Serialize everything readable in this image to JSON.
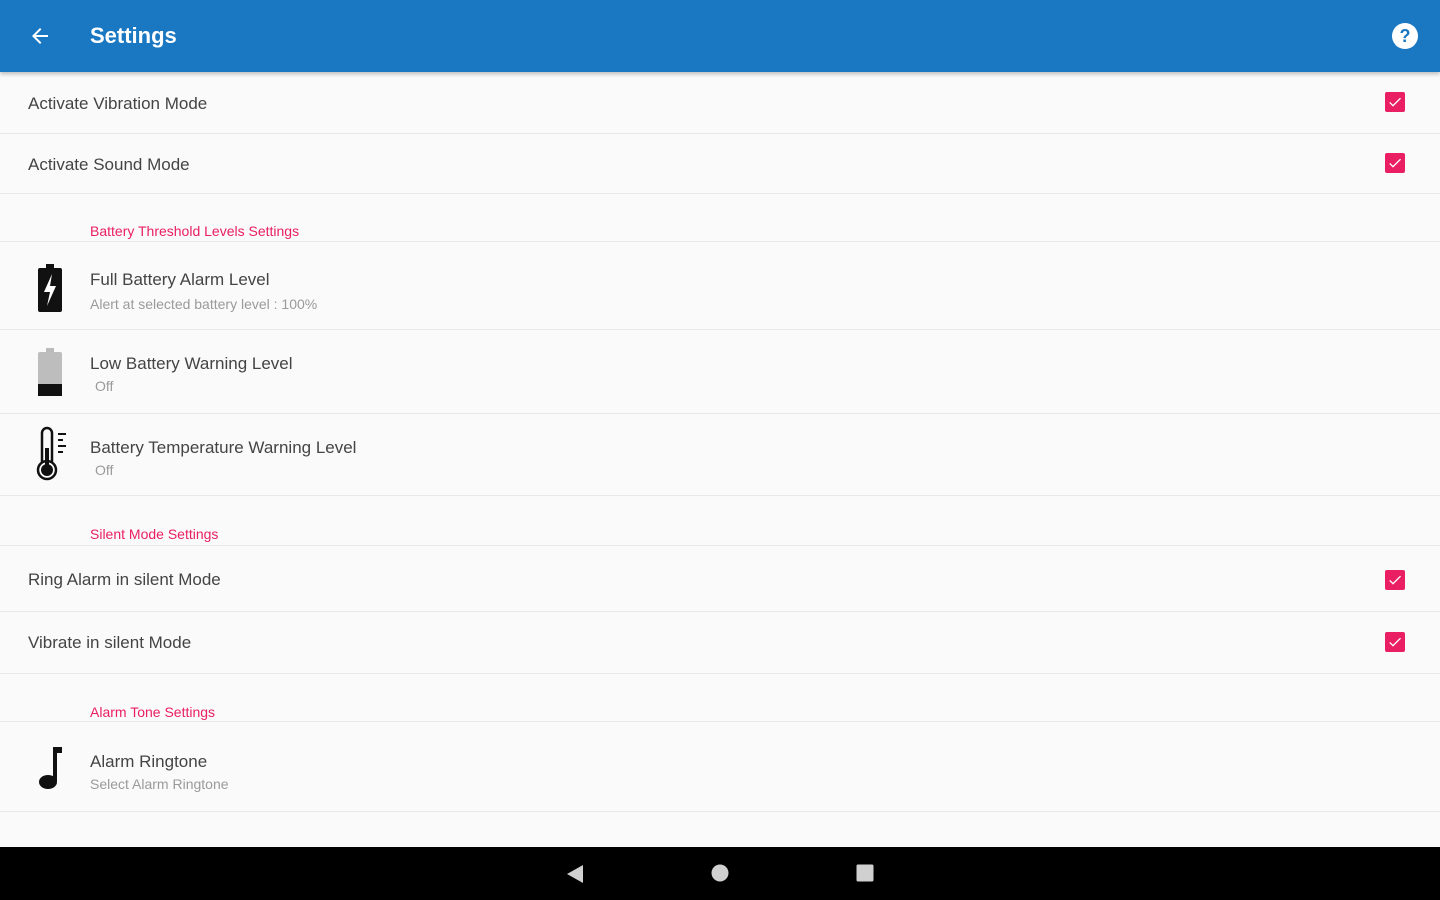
{
  "appbar": {
    "title": "Settings",
    "back_icon": "arrow-left-icon",
    "help_icon": "help-circle-icon",
    "help_glyph": "?",
    "color": "#1a78c2"
  },
  "accent_color": "#e91e63",
  "rows": {
    "vibration": {
      "label": "Activate Vibration Mode",
      "checked": true
    },
    "sound": {
      "label": "Activate Sound Mode",
      "checked": true
    }
  },
  "battery_section": {
    "header": "Battery Threshold Levels Settings",
    "items": [
      {
        "title": "Full Battery Alarm Level",
        "summary": "Alert at selected battery level : 100%",
        "icon": "battery-charging-icon"
      },
      {
        "title": "Low Battery Warning Level",
        "summary": "Off",
        "icon": "battery-low-icon"
      },
      {
        "title": "Battery Temperature Warning Level",
        "summary": "Off",
        "icon": "thermometer-icon"
      }
    ]
  },
  "silent_section": {
    "header": "Silent Mode Settings",
    "rows": [
      {
        "label": "Ring Alarm in silent Mode",
        "checked": true
      },
      {
        "label": "Vibrate in silent Mode",
        "checked": true
      }
    ]
  },
  "alarm_tone_section": {
    "header": "Alarm Tone Settings",
    "items": [
      {
        "title": "Alarm Ringtone",
        "summary": "Select Alarm Ringtone",
        "icon": "music-note-icon"
      }
    ]
  },
  "navbar": {
    "back_icon": "nav-back-icon",
    "home_icon": "nav-home-icon",
    "recents_icon": "nav-recents-icon"
  }
}
